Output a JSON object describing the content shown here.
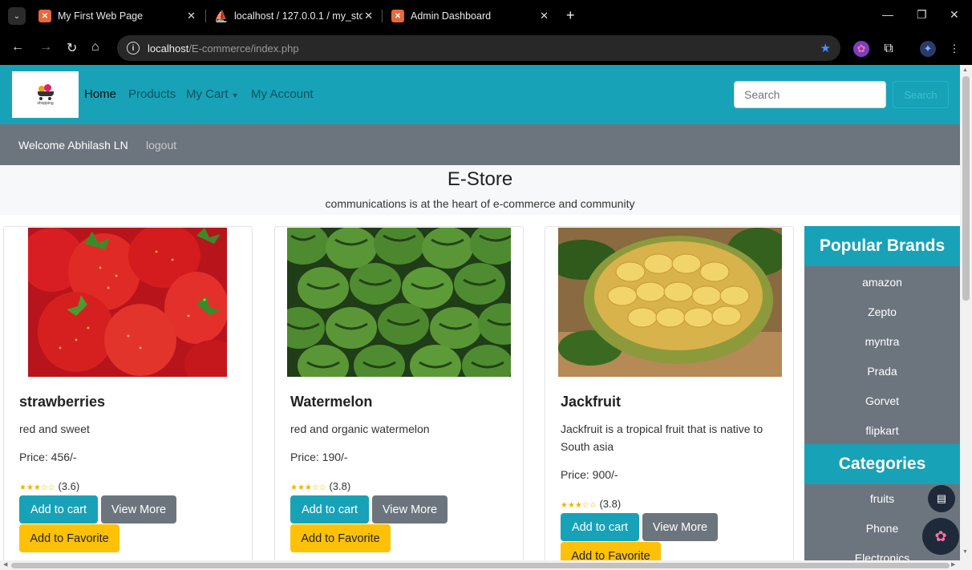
{
  "browser": {
    "tabs": [
      {
        "title": "My First Web Page"
      },
      {
        "title": "localhost / 127.0.0.1 / my_store"
      },
      {
        "title": "Admin Dashboard"
      }
    ],
    "address": {
      "host": "localhost",
      "path": "/E-commerce/index.php"
    }
  },
  "navbar": {
    "logo_text": "shopping",
    "links": [
      "Home",
      "Products",
      "My Cart",
      "My Account"
    ],
    "search_placeholder": "Search",
    "search_button": "Search"
  },
  "user_bar": {
    "welcome": "Welcome Abhilash LN",
    "logout": "logout"
  },
  "hero": {
    "title": "E-Store",
    "tagline": "communications is at the heart of e-commerce and community"
  },
  "products": [
    {
      "name": "strawberries",
      "description": "red and sweet",
      "price": "Price: 456/-",
      "stars": "★★★☆☆",
      "rating": "(3.6)",
      "add_to_cart": "Add to cart",
      "view_more": "View More",
      "add_to_favorite": "Add to Favorite"
    },
    {
      "name": "Watermelon",
      "description": "red and organic watermelon",
      "price": "Price: 190/-",
      "stars": "★★★☆☆",
      "rating": "(3.8)",
      "add_to_cart": "Add to cart",
      "view_more": "View More",
      "add_to_favorite": "Add to Favorite"
    },
    {
      "name": "Jackfruit",
      "description": "Jackfruit is a tropical fruit that is native to South asia",
      "price": "Price: 900/-",
      "stars": "★★★☆☆",
      "rating": "(3.8)",
      "add_to_cart": "Add to cart",
      "view_more": "View More",
      "add_to_favorite": "Add to Favorite"
    }
  ],
  "sidebar": {
    "brands_title": "Popular Brands",
    "brands": [
      "amazon",
      "Zepto",
      "myntra",
      "Prada",
      "Gorvet",
      "flipkart"
    ],
    "categories_title": "Categories",
    "categories": [
      "fruits",
      "Phone",
      "Electronics"
    ]
  },
  "colors": {
    "primary": "#17a2b8",
    "secondary": "#6c757d",
    "warning": "#ffc107"
  }
}
